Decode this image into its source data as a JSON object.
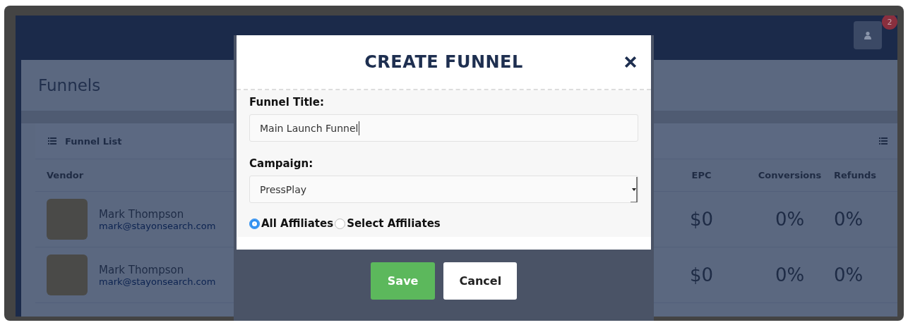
{
  "header": {
    "notification_count": "2"
  },
  "page": {
    "title": "Funnels"
  },
  "panel": {
    "title": "Funnel List"
  },
  "table": {
    "columns": [
      "Vendor",
      "EPC",
      "Conversions",
      "Refunds"
    ],
    "rows": [
      {
        "name": "Mark Thompson",
        "email": "mark@stayonsearch.com",
        "epc": "$0",
        "conversions": "0%",
        "refunds": "0%"
      },
      {
        "name": "Mark Thompson",
        "email": "mark@stayonsearch.com",
        "epc": "$0",
        "conversions": "0%",
        "refunds": "0%"
      }
    ]
  },
  "modal": {
    "title": "CREATE FUNNEL",
    "fields": [
      {
        "kind": "text",
        "label": "Funnel Title:",
        "value": "Main Launch Funnel"
      },
      {
        "kind": "select",
        "label": "Campaign:",
        "value": "PressPlay"
      }
    ],
    "radios": [
      {
        "label": "All Affiliates",
        "selected": true
      },
      {
        "label": "Select Affiliates",
        "selected": false
      }
    ],
    "buttons": [
      {
        "kind": "primary",
        "label": "Save"
      },
      {
        "kind": "default",
        "label": "Cancel"
      }
    ]
  }
}
